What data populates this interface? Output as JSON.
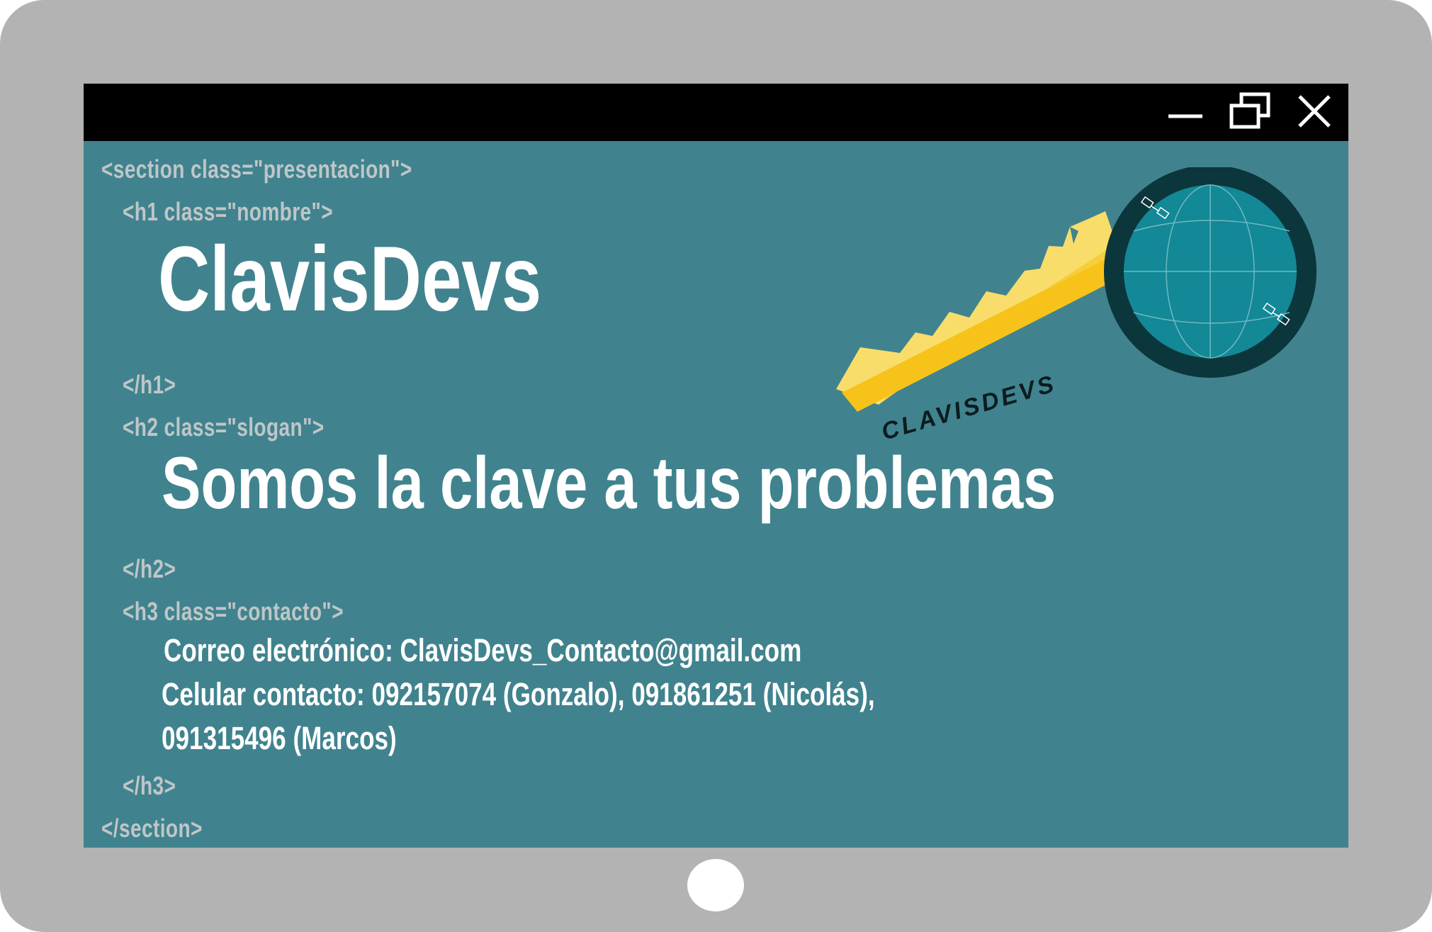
{
  "window": {
    "controls": {
      "minimize_icon": "minimize-icon",
      "restore_icon": "restore-icon",
      "close_icon": "close-icon"
    }
  },
  "code": {
    "section_open": "<section class=\"presentacion\">",
    "h1_open": "<h1 class=\"nombre\">",
    "h1_close": "</h1>",
    "h2_open": "<h2 class=\"slogan\">",
    "h2_close": "</h2>",
    "h3_open": "<h3 class=\"contacto\">",
    "h3_close": "</h3>",
    "section_close": "</section>"
  },
  "content": {
    "name": "ClavisDevs",
    "slogan": "Somos la clave a tus problemas",
    "contact_email": "Correo electrónico: ClavisDevs_Contacto@gmail.com",
    "contact_phone_1": "Celular contacto: 092157074 (Gonzalo), 091861251 (Nicolás),",
    "contact_phone_2": "091315496 (Marcos)"
  },
  "logo": {
    "wordmark": "CLAVISDEVS"
  },
  "colors": {
    "frame": "#b3b3b3",
    "screen": "#40838e",
    "titlebar": "#000000",
    "code_text": "#bfc6c8",
    "content_text": "#ffffff",
    "key_gold": "#f7c31a",
    "globe_ring": "#0b363b",
    "globe_fill": "#138896"
  }
}
